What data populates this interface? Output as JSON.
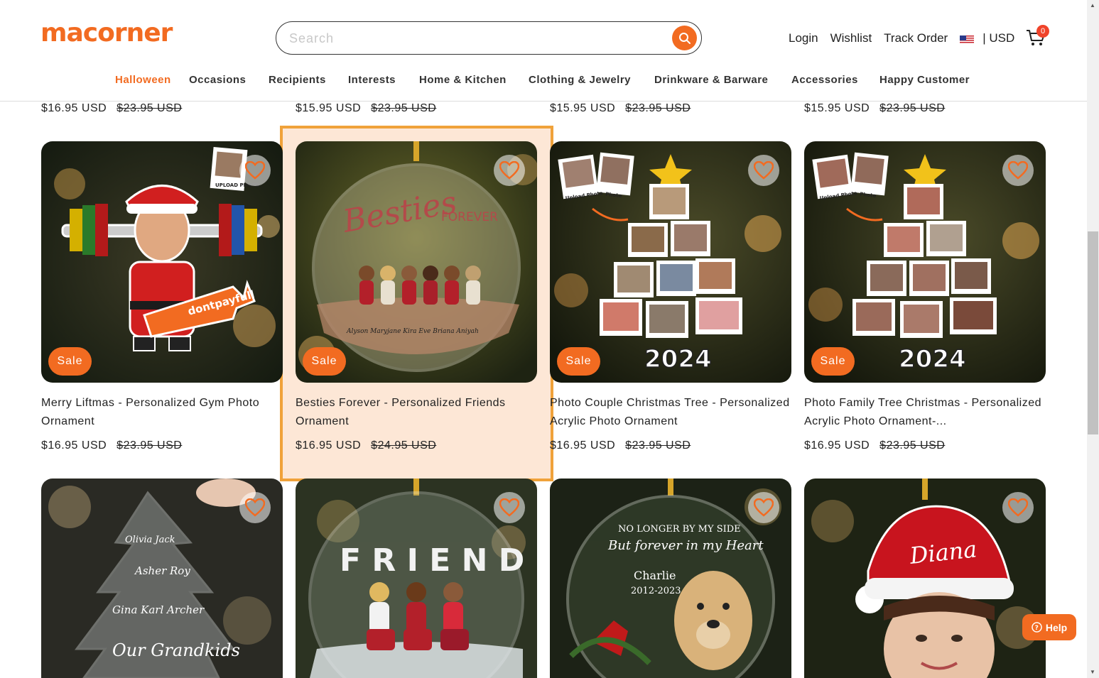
{
  "header": {
    "logo": "macorner",
    "search_placeholder": "Search",
    "links": {
      "login": "Login",
      "wishlist": "Wishlist",
      "track_order": "Track Order"
    },
    "currency": "| USD",
    "cart_count": "0"
  },
  "nav": [
    "Halloween",
    "Occasions",
    "Recipients",
    "Interests",
    "Home & Kitchen",
    "Clothing & Jewelry",
    "Drinkware & Barware",
    "Accessories",
    "Happy Customer"
  ],
  "prev_row_prices": [
    {
      "price": "$16.95 USD",
      "old": "$23.95 USD"
    },
    {
      "price": "$15.95 USD",
      "old": "$23.95 USD"
    },
    {
      "price": "$15.95 USD",
      "old": "$23.95 USD"
    },
    {
      "price": "$15.95 USD",
      "old": "$23.95 USD"
    }
  ],
  "products": [
    {
      "badge": "Sale",
      "title": "Merry Liftmas - Personalized Gym Photo Ornament",
      "price": "$16.95 USD",
      "old": "$23.95 USD",
      "image_label": "dontpayfull",
      "photo_tag": "UPLOAD PHOTO"
    },
    {
      "badge": "Sale",
      "title": "Besties Forever - Personalized Friends Ornament",
      "price": "$16.95 USD",
      "old": "$24.95 USD",
      "image_title": "Besties",
      "image_subtitle": "FOREVER",
      "names": "Alyson   Maryjane   Kira   Eve   Briana   Aniyah"
    },
    {
      "badge": "Sale",
      "title": "Photo Couple Christmas Tree - Personalized Acrylic Photo Ornament",
      "price": "$16.95 USD",
      "old": "$23.95 USD",
      "year": "2024",
      "photo_tags": [
        "Upload Photo",
        "Photo"
      ]
    },
    {
      "badge": "Sale",
      "title": "Photo Family Tree Christmas - Personalized Acrylic Photo Ornament-...",
      "price": "$16.95 USD",
      "old": "$23.95 USD",
      "year": "2024",
      "photo_tags": [
        "Upload Photo",
        "Photo"
      ]
    }
  ],
  "next_row": [
    {
      "image_text": [
        "Olivia  Jack",
        "Asher  Roy",
        "Gina  Karl  Archer",
        "Our Grandkids"
      ]
    },
    {
      "image_text": [
        "F R I E N D S"
      ]
    },
    {
      "image_text": [
        "NO LONGER BY MY SIDE",
        "But forever in my Heart",
        "Charlie",
        "2012-2023"
      ]
    },
    {
      "image_text": [
        "Diana"
      ]
    }
  ],
  "help_label": "Help"
}
